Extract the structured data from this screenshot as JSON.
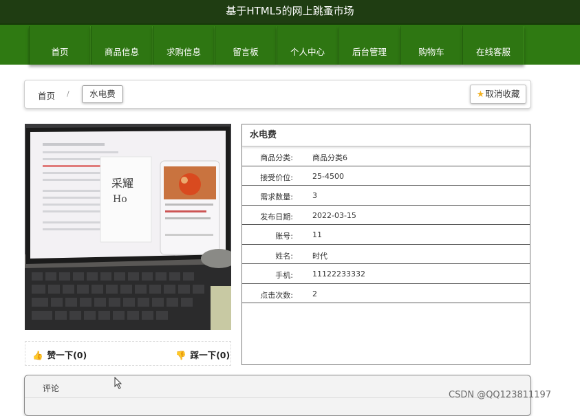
{
  "header": {
    "site_title": "基于HTML5的网上跳蚤市场"
  },
  "nav": {
    "items": [
      {
        "label": "首页"
      },
      {
        "label": "商品信息"
      },
      {
        "label": "求购信息"
      },
      {
        "label": "留言板"
      },
      {
        "label": "个人中心"
      },
      {
        "label": "后台管理"
      },
      {
        "label": "购物车"
      },
      {
        "label": "在线客服"
      }
    ]
  },
  "breadcrumb": {
    "home": "首页",
    "separator": "/",
    "current": "水电费",
    "favorite_button": "取消收藏"
  },
  "votes": {
    "like": "赞一下(0)",
    "dislike": "踩一下(0)"
  },
  "detail": {
    "title": "水电费",
    "rows": [
      {
        "label": "商品分类:",
        "value": "商品分类6"
      },
      {
        "label": "接受价位:",
        "value": "25-4500"
      },
      {
        "label": "需求数量:",
        "value": "3"
      },
      {
        "label": "发布日期:",
        "value": "2022-03-15"
      },
      {
        "label": "账号:",
        "value": "11"
      },
      {
        "label": "姓名:",
        "value": "时代"
      },
      {
        "label": "手机:",
        "value": "11122233332"
      },
      {
        "label": "点击次数:",
        "value": "2"
      }
    ]
  },
  "comments": {
    "label": "评论"
  },
  "watermark": "CSDN @QQ123811197",
  "colors": {
    "topbar": "#1f3d12",
    "navbar": "#2f7a12",
    "star": "#f2b01e",
    "vote_icon": "#e03b3b"
  }
}
